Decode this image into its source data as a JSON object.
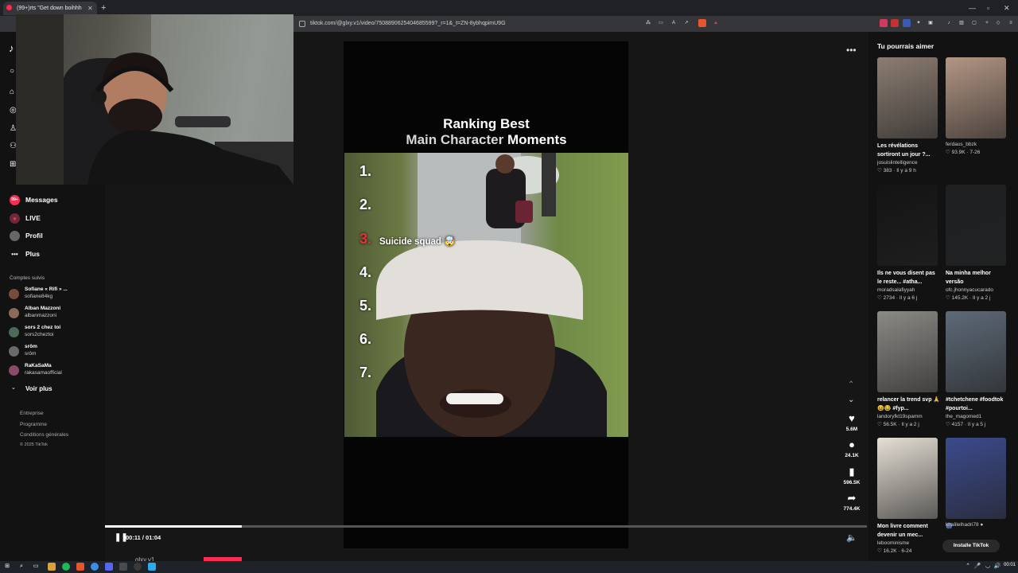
{
  "browser": {
    "tab_title": "(99+)rts \"Get down boihhh",
    "url": "tiktok.com/@glxy.v1/video/7508890625404685599?_r=1&_t=ZN-8ybhqpimU9G",
    "new_tab_symbol": "+",
    "close_symbol": "✕"
  },
  "sidebar": {
    "nav": [
      {
        "label": "Messages",
        "badge": "99+"
      },
      {
        "label": "LIVE"
      },
      {
        "label": "Profil"
      },
      {
        "label": "Plus"
      }
    ],
    "following_title": "Comptes suivis",
    "accounts": [
      {
        "name": "Sofiane « Rifi » ...",
        "handle": "sofiane84kg"
      },
      {
        "name": "Alban Mazzoni",
        "handle": "albanmazzoni"
      },
      {
        "name": "sors 2 chez toi",
        "handle": "sors2cheztoi"
      },
      {
        "name": "srôm",
        "handle": "srôm"
      },
      {
        "name": "RaKaSaMa",
        "handle": "rakasamaofficial"
      }
    ],
    "see_more": "Voir plus",
    "footer": [
      "Entreprise",
      "Programme",
      "Conditions générales",
      "© 2025 TikTok"
    ]
  },
  "video": {
    "title_line1": "Ranking Best",
    "title_line2_a": "Main Character",
    "title_line2_b": "Moments",
    "ranks": [
      "1.",
      "2.",
      "3.",
      "4.",
      "5.",
      "6.",
      "7."
    ],
    "rank3_label": "Suicide squad 🤯",
    "time": "00:11 / 01:04",
    "progress_fraction": 0.18,
    "author_strip": "glxy.v1",
    "more_symbol": "•••",
    "actions": [
      {
        "icon": "heart-icon",
        "count": "5.6M"
      },
      {
        "icon": "comment-icon",
        "count": "24.1K"
      },
      {
        "icon": "bookmark-icon",
        "count": "596.5K"
      },
      {
        "icon": "share-icon",
        "count": "774.4K"
      }
    ]
  },
  "recommendations": {
    "title": "Tu pourrais aimer",
    "items": [
      {
        "caption": "Les révélations sortiront un jour ?...",
        "author": "josuislintelligence",
        "stats": "♡ 383 · Il y a 9 h",
        "tone": "#8c7d72"
      },
      {
        "caption": "",
        "author": "ferdaus_bbzk",
        "stats": "♡ 93.9K · 7-26",
        "tone": "#b39684"
      },
      {
        "caption": "Ils ne vous disent pas le reste... #atha...",
        "author": "moradsalafiyyah",
        "stats": "♡ 2734 · Il y a 6 j",
        "tone": "#141414"
      },
      {
        "caption": "Na minha melhor versão",
        "author": "ofc.jhonnyacucarado",
        "stats": "♡ 145.2K · Il y a 2 j",
        "tone": "#1e2022"
      },
      {
        "caption": "relancer la trend svp 🙏😆😂 #fyp...",
        "author": "landoryfkt19spamm",
        "stats": "♡ 56.5K · Il y a 2 j",
        "tone": "#8c8a86"
      },
      {
        "caption": "#tchetchene #foodtok #pourtoi...",
        "author": "the_magomed1",
        "stats": "♡ 4157 · Il y a 5 j",
        "tone": "#5e6a78"
      },
      {
        "caption": "Mon livre comment devenir un mec...",
        "author": "leboominisme",
        "stats": "♡ 16.2K · 6-24",
        "tone": "#e6e0d6"
      },
      {
        "caption": "🎆",
        "author": "khalilelhadri78 ●",
        "stats": "",
        "tone": "#3c4a8c"
      }
    ],
    "install": "Installe TikTok"
  },
  "taskbar": {
    "clock": "00:01"
  }
}
